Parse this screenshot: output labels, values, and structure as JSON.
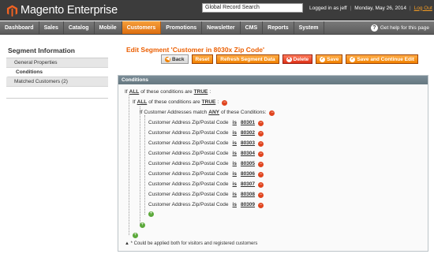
{
  "header": {
    "logo_main": "Magento",
    "logo_sub": " Enterprise",
    "search_value": "Global Record Search",
    "logged_in": "Logged in as jeff",
    "date": "Monday, May 26, 2014",
    "logout": "Log Out"
  },
  "nav": {
    "items": [
      "Dashboard",
      "Sales",
      "Catalog",
      "Mobile",
      "Customers",
      "Promotions",
      "Newsletter",
      "CMS",
      "Reports",
      "System"
    ],
    "active": "Customers",
    "help": "Get help for this page"
  },
  "sidebar": {
    "title": "Segment Information",
    "items": [
      "General Properties",
      "Conditions",
      "Matched Customers (2)"
    ],
    "active": "Conditions"
  },
  "page": {
    "title": "Edit Segment 'Customer in 8030x Zip Code'",
    "buttons": {
      "back": "Back",
      "reset": "Reset",
      "refresh": "Refresh Segment Data",
      "delete": "Delete",
      "save": "Save",
      "save_continue": "Save and Continue Edit"
    }
  },
  "conditions": {
    "header": "Conditions",
    "root": {
      "if": "If",
      "agg": "ALL",
      "mid": "of these conditions are",
      "val": "TRUE",
      "end": ":"
    },
    "group": {
      "if": "If",
      "agg": "ALL",
      "mid": "of these conditions are",
      "val": "TRUE",
      "end": ":"
    },
    "address": {
      "text": "If Customer Addresses match",
      "agg": "ANY",
      "end": "of these Conditions:"
    },
    "rule_label": "Customer Address Zip/Postal Code",
    "rule_op": "is",
    "zips": [
      "80301",
      "80302",
      "80303",
      "80304",
      "80305",
      "80306",
      "80307",
      "80308",
      "80309"
    ],
    "footnote": "* Could be applied both for visitors and registered customers"
  },
  "colors": {
    "accent": "#eb5e00",
    "button": "#f18200",
    "delete": "#de3016",
    "add": "#5ba93a"
  }
}
